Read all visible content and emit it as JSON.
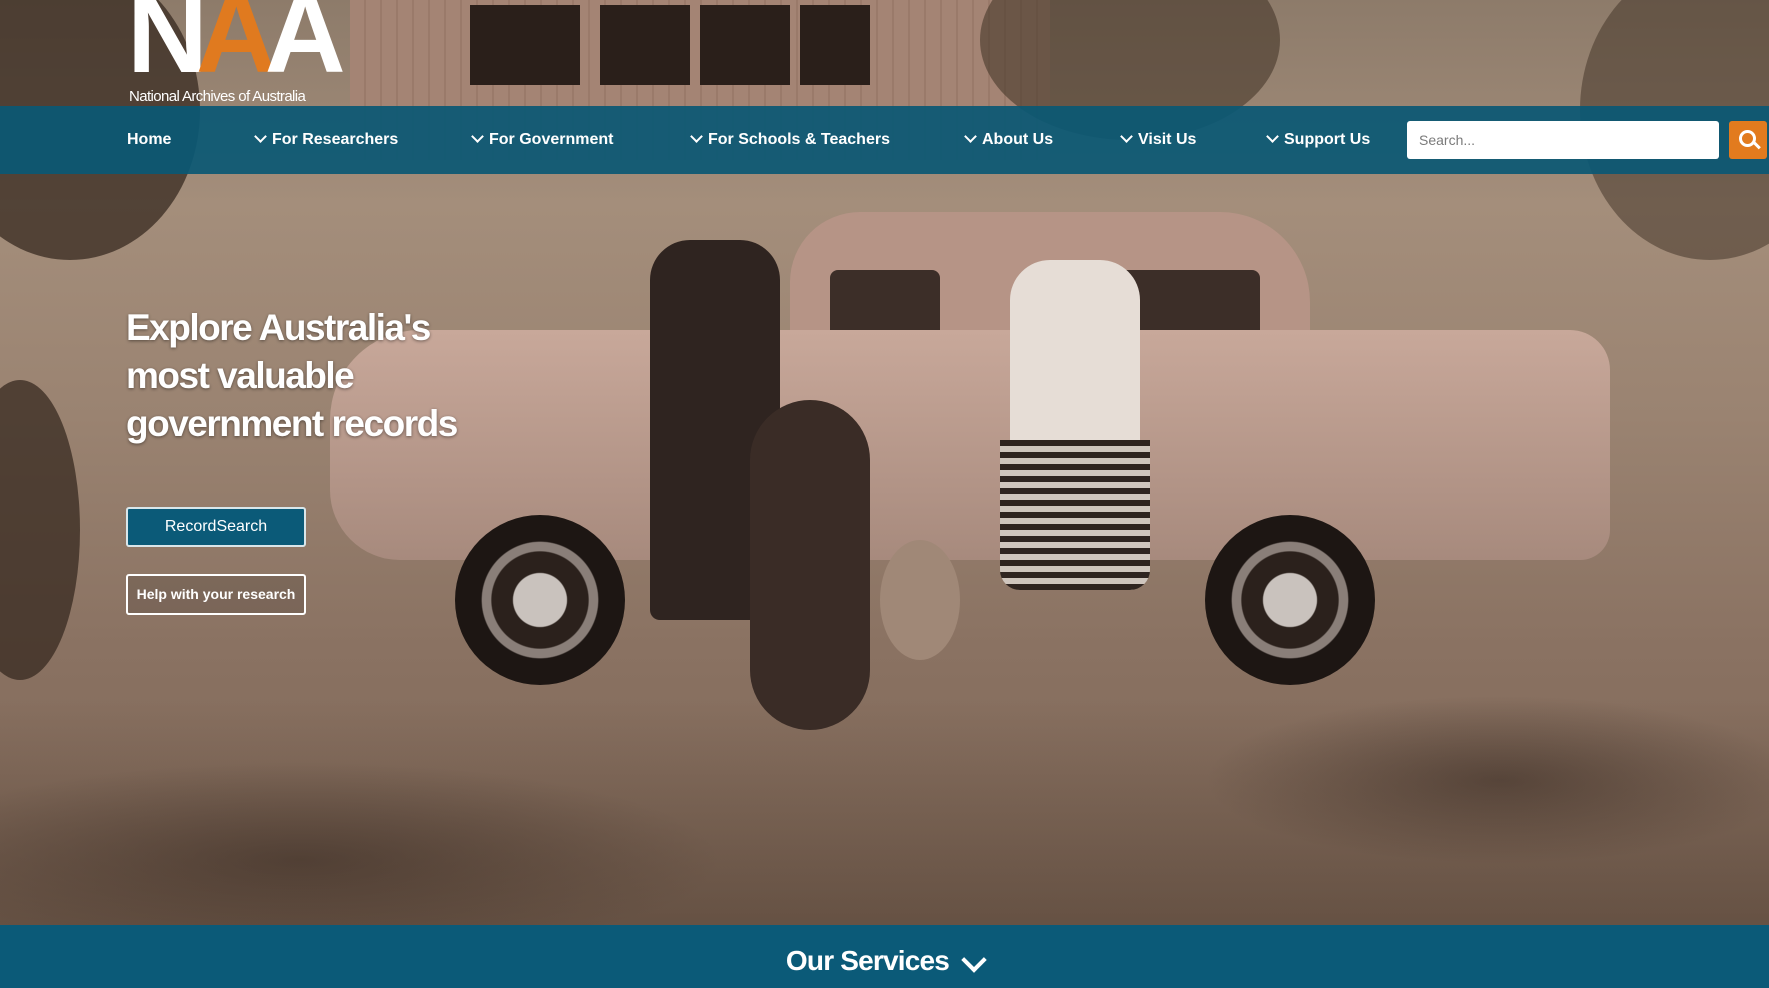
{
  "logo": {
    "letters": [
      "N",
      "A",
      "A"
    ],
    "tagline": "National Archives of Australia",
    "accent_color": "#e07a1f"
  },
  "nav": {
    "items": [
      {
        "label": "Home",
        "has_dropdown": false
      },
      {
        "label": "For Researchers",
        "has_dropdown": true
      },
      {
        "label": "For Government",
        "has_dropdown": true
      },
      {
        "label": "For Schools & Teachers",
        "has_dropdown": true
      },
      {
        "label": "About Us",
        "has_dropdown": true
      },
      {
        "label": "Visit Us",
        "has_dropdown": true
      },
      {
        "label": "Support Us",
        "has_dropdown": true
      }
    ],
    "bar_color": "#0a5874"
  },
  "search": {
    "placeholder": "Search...",
    "value": "",
    "button_icon": "search-icon",
    "button_color": "#e27b1e"
  },
  "hero": {
    "title_lines": [
      "Explore Australia's",
      "most valuable",
      "government records"
    ],
    "primary_button": "RecordSearch",
    "secondary_button": "Help with your research"
  },
  "services": {
    "label": "Our Services",
    "icon": "chevron-down-icon",
    "bar_color": "#0b5a78"
  }
}
